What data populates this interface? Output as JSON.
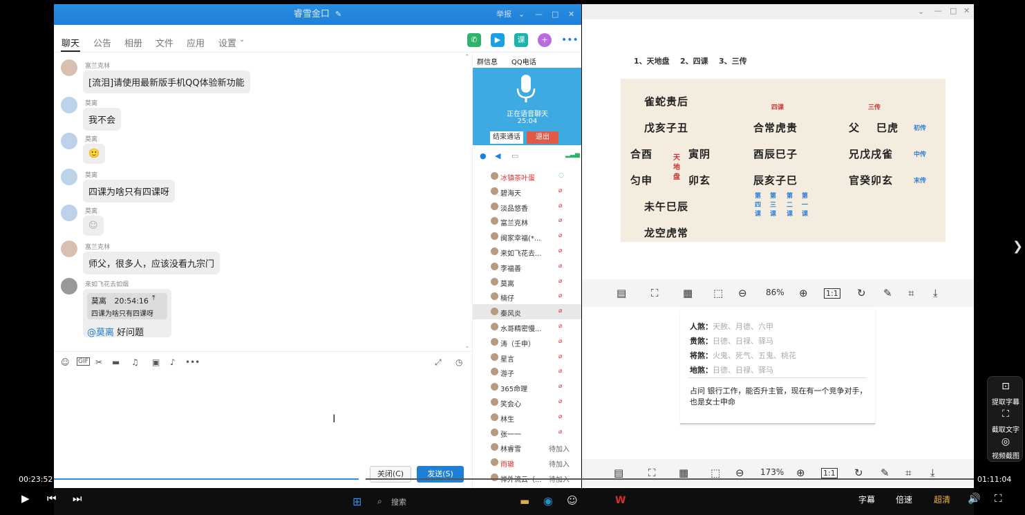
{
  "qq": {
    "title": "睿雪金口",
    "title_edit_icon": "edit-icon",
    "title_right_label": "举报",
    "tabs": [
      "聊天",
      "公告",
      "相册",
      "文件",
      "应用",
      "设置"
    ],
    "messages": [
      {
        "nick": "富兰克林",
        "text": "[流泪]请使用最新版手机QQ体验新功能"
      },
      {
        "nick": "莫离",
        "text": "我不会"
      },
      {
        "nick": "莫离",
        "text": "🙂"
      },
      {
        "nick": "莫离",
        "text": "四课为啥只有四课呀"
      },
      {
        "nick": "莫离",
        "text": "☺"
      },
      {
        "nick": "富兰克林",
        "text": "师父，很多人，应该没看九宗门"
      },
      {
        "nick": "来如飞花去如烟",
        "quote_name": "莫离",
        "quote_time": "20:54:16",
        "quote_text": "四课为啥只有四课呀",
        "mention": "@莫离",
        "reply": "好问题"
      }
    ],
    "close_button": "关闭(C)",
    "send_button": "发送(S)",
    "side_tabs": [
      "群信息",
      "QQ电话"
    ],
    "voice_status": "正在语音聊天",
    "voice_time": "25:04",
    "end_call": "结束通话",
    "exit": "退出",
    "members": [
      {
        "name": "冰镇茶叶蛋",
        "status": ""
      },
      {
        "name": "碧海天",
        "status": ""
      },
      {
        "name": "淡品悠香",
        "status": ""
      },
      {
        "name": "富兰克林",
        "status": ""
      },
      {
        "name": "闽家幸福(*...",
        "status": ""
      },
      {
        "name": "来如飞花去...",
        "status": ""
      },
      {
        "name": "李福善",
        "status": ""
      },
      {
        "name": "莫离",
        "status": ""
      },
      {
        "name": "楠仔",
        "status": ""
      },
      {
        "name": "秦风炎",
        "status": ""
      },
      {
        "name": "水哥精密慢...",
        "status": ""
      },
      {
        "name": "涛（壬申）",
        "status": ""
      },
      {
        "name": "星言",
        "status": ""
      },
      {
        "name": "游子",
        "status": ""
      },
      {
        "name": "365命理",
        "status": ""
      },
      {
        "name": "笑会心",
        "status": ""
      },
      {
        "name": "林生",
        "status": ""
      },
      {
        "name": "张一一",
        "status": ""
      },
      {
        "name": "林睿雪",
        "status": "待加入"
      },
      {
        "name": "雨辙",
        "status": "待加入"
      },
      {
        "name": "禅外流云（...",
        "status": "待加入"
      }
    ]
  },
  "doc": {
    "heading": "1、天地盘    2、四课    3、三传",
    "chart": {
      "row1": "雀蛇贵后",
      "col_label_sike": "四课",
      "col_label_sanchuan": "三传",
      "r2a": "戊亥子丑",
      "r2b": "合常虎贵",
      "r2c": "父",
      "r2d": "巳虎",
      "r2e": "初传",
      "r3a": "合酉",
      "r3b": "寅阴",
      "r3c": "酉辰巳子",
      "r3d": "兄戊戌雀",
      "r3e": "中传",
      "tiandipan": "天地盘",
      "r4a": "匀申",
      "r4b": "卯玄",
      "r4c": "辰亥子巳",
      "r4d": "官癸卯玄",
      "r4e": "末传",
      "r5a": "未午巳辰",
      "ke": [
        "第四课",
        "第三课",
        "第二课",
        "第一课"
      ],
      "r6a": "龙空虎常"
    },
    "zoom1": "86%",
    "zoom2": "173%",
    "sha": [
      {
        "label": "人煞：",
        "value": "天赦、月德、六甲"
      },
      {
        "label": "贵煞：",
        "value": "日德、日禄、驿马"
      },
      {
        "label": "将煞：",
        "value": "火鬼、死气、五鬼、桃花"
      },
      {
        "label": "地煞：",
        "value": "日德、日禄、驿马"
      }
    ],
    "zhan": "占问  银行工作，能否升主管，现在有一个竞争对手，也是女士申命"
  },
  "player": {
    "current_time": "00:23:52",
    "total_time": "01:11:04",
    "progress": 0.335,
    "subtitle": "字幕",
    "speed": "倍速",
    "quality": "超清",
    "side": [
      "提取字幕",
      "截取文字",
      "视频截图"
    ],
    "taskbar_search": "搜索"
  }
}
